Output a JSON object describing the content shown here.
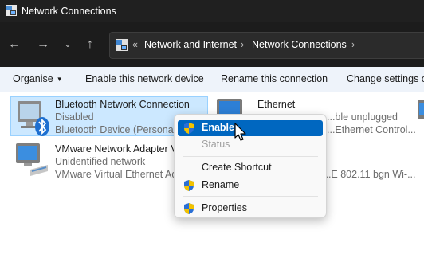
{
  "window": {
    "title": "Network Connections"
  },
  "address_bar": {
    "overflow": "«",
    "path": [
      "Network and Internet",
      "Network Connections"
    ],
    "separator": "›"
  },
  "command_bar": {
    "organise": "Organise",
    "enable": "Enable this network device",
    "rename": "Rename this connection",
    "change": "Change settings of"
  },
  "connections": [
    {
      "name": "Bluetooth Network Connection",
      "status": "Disabled",
      "device": "Bluetooth Device (Personal A",
      "selected": true
    },
    {
      "name": "Ethernet",
      "status": "...ble unplugged",
      "device": "...Ethernet Control..."
    },
    {
      "name": "VMware Network Adapter VI",
      "status": "Unidentified network",
      "device": "VMware Virtual Ethernet Ada"
    },
    {
      "device": "...E 802.11 bgn Wi-..."
    }
  ],
  "context_menu": {
    "enable": "Enable",
    "status": "Status",
    "create_shortcut": "Create Shortcut",
    "rename": "Rename",
    "properties": "Properties"
  },
  "colors": {
    "titlebar_bg": "#202020",
    "selection_bg": "#cce8ff",
    "menu_highlight": "#0067c0",
    "command_bar_bg": "#eef3fa"
  }
}
